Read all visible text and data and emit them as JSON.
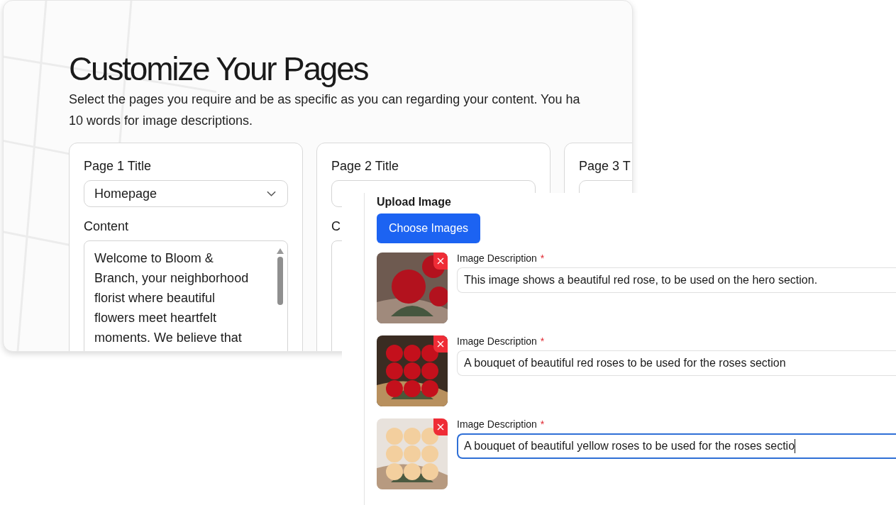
{
  "heading": "Customize Your Pages",
  "intro_lines": [
    "Select the pages you require and be as specific as you can regarding your content. You ha",
    "10 words for image descriptions."
  ],
  "pages": [
    {
      "title_label": "Page 1 Title",
      "select_value": "Homepage",
      "content_label": "Content",
      "content_lines": [
        "Welcome to Bloom &",
        "Branch, your neighborhood",
        "florist where beautiful",
        "flowers meet heartfelt",
        "moments. We believe that"
      ]
    },
    {
      "title_label": "Page 2 Title",
      "content_label": "C"
    },
    {
      "title_label": "Page 3 T"
    }
  ],
  "upload": {
    "label": "Upload Image",
    "button": "Choose Images",
    "items": [
      {
        "label": "Image Description",
        "required_mark": "*",
        "value": "This image shows a beautiful red rose, to be used on the hero section.",
        "focused": false
      },
      {
        "label": "Image Description",
        "required_mark": "*",
        "value": "A bouquet of beautiful red roses to be used for the roses section",
        "focused": false
      },
      {
        "label": "Image Description",
        "required_mark": "*",
        "value": "A bouquet of beautiful yellow roses to be used for the roses sectio",
        "focused": true
      }
    ]
  }
}
